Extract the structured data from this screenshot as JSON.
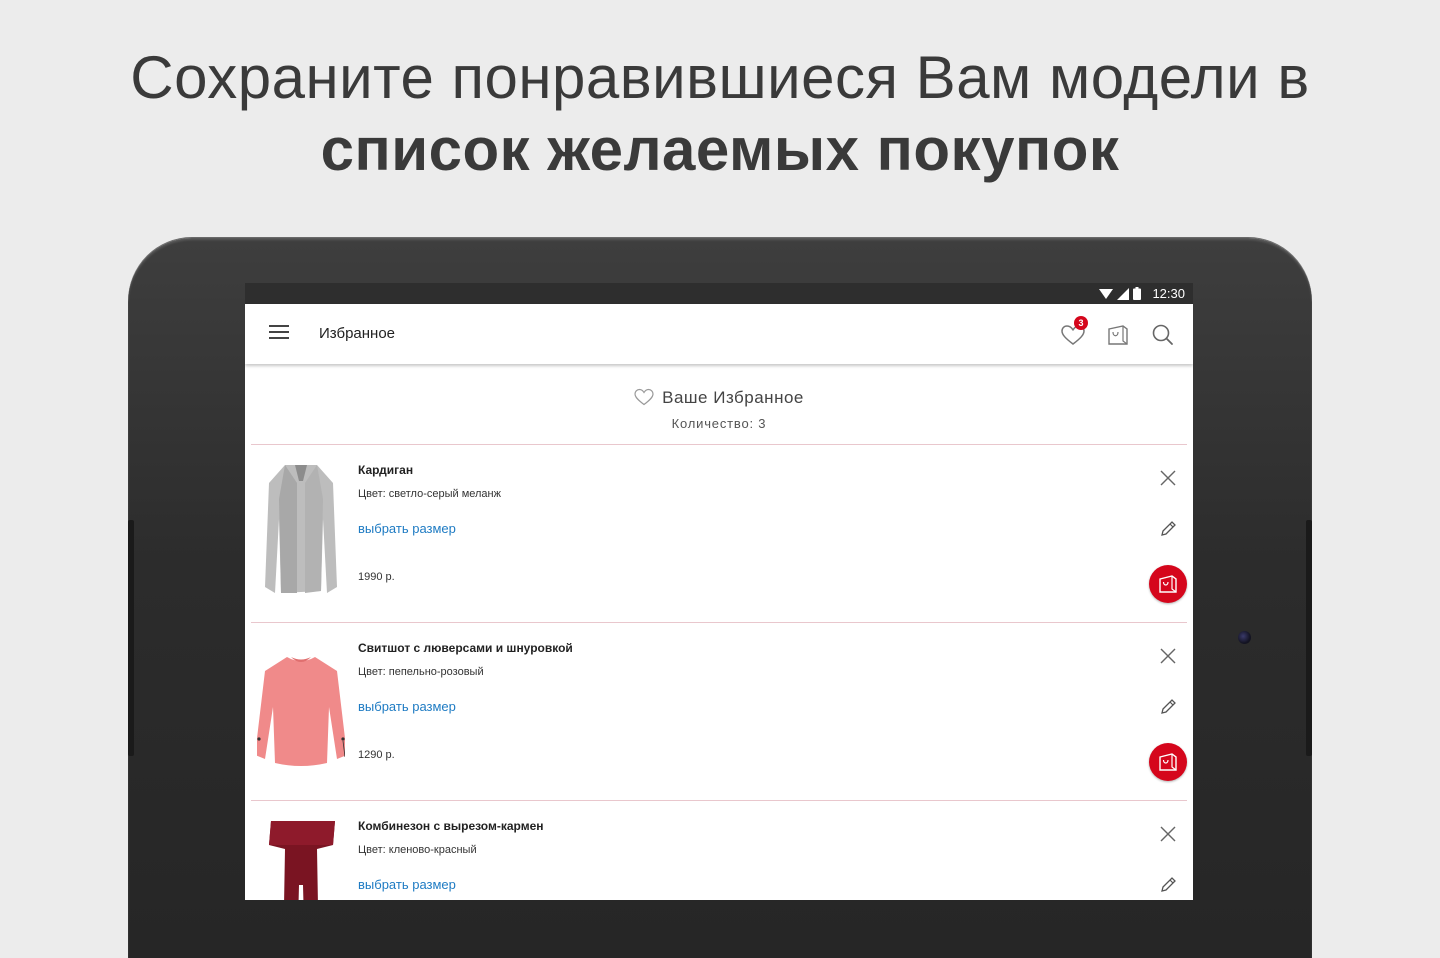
{
  "promo": {
    "line1": "Сохраните понравившиеся Вам модели в",
    "line2": "список желаемых покупок"
  },
  "status": {
    "time": "12:30"
  },
  "appbar": {
    "title": "Избранное",
    "wishlist_badge": "3",
    "icons": [
      "menu-icon",
      "heart-icon",
      "shopping-bag-icon",
      "search-icon"
    ]
  },
  "favorites": {
    "title": "Ваше Избранное",
    "count_label": "Количество: 3"
  },
  "items": [
    {
      "name": "Кардиган",
      "color": "Цвет: светло-серый меланж",
      "size_link": "выбрать размер",
      "price": "1990 р."
    },
    {
      "name": "Свитшот с люверсами и шнуровкой",
      "color": "Цвет: пепельно-розовый",
      "size_link": "выбрать размер",
      "price": "1290 р."
    },
    {
      "name": "Комбинезон с вырезом-кармен",
      "color": "Цвет: кленово-красный",
      "size_link": "выбрать размер",
      "price": ""
    }
  ],
  "colors": {
    "accent": "#d5061c",
    "link": "#1e7bc3",
    "divider": "#e9c7cd"
  }
}
